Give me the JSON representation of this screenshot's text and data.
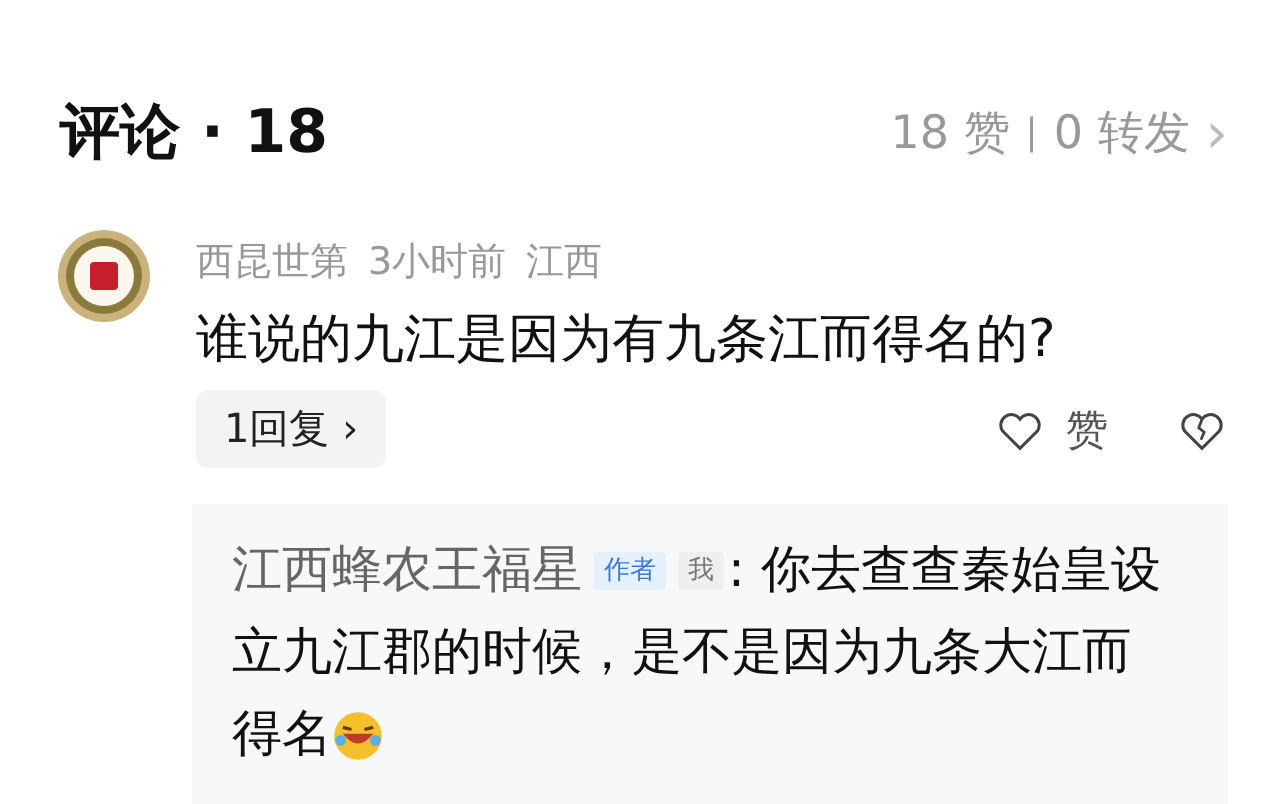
{
  "header": {
    "title": "评论 · 18",
    "likes": "18 赞",
    "separator": "|",
    "shares": "0 转发",
    "chevron": "›"
  },
  "comment": {
    "author": "西昆世第",
    "time": "3小时前",
    "location": "江西",
    "text": "谁说的九江是因为有九条江而得名的?",
    "reply_button": "1回复 ›",
    "like_label": "赞",
    "liked": false,
    "reply": {
      "author": "江西蜂农王福星",
      "badges": [
        {
          "label": "作者",
          "kind": "author"
        },
        {
          "label": "我",
          "kind": "me"
        }
      ],
      "text": ": 你去查查秦始皇设立九江郡的时候，是不是因为九条大江而得名"
    }
  }
}
